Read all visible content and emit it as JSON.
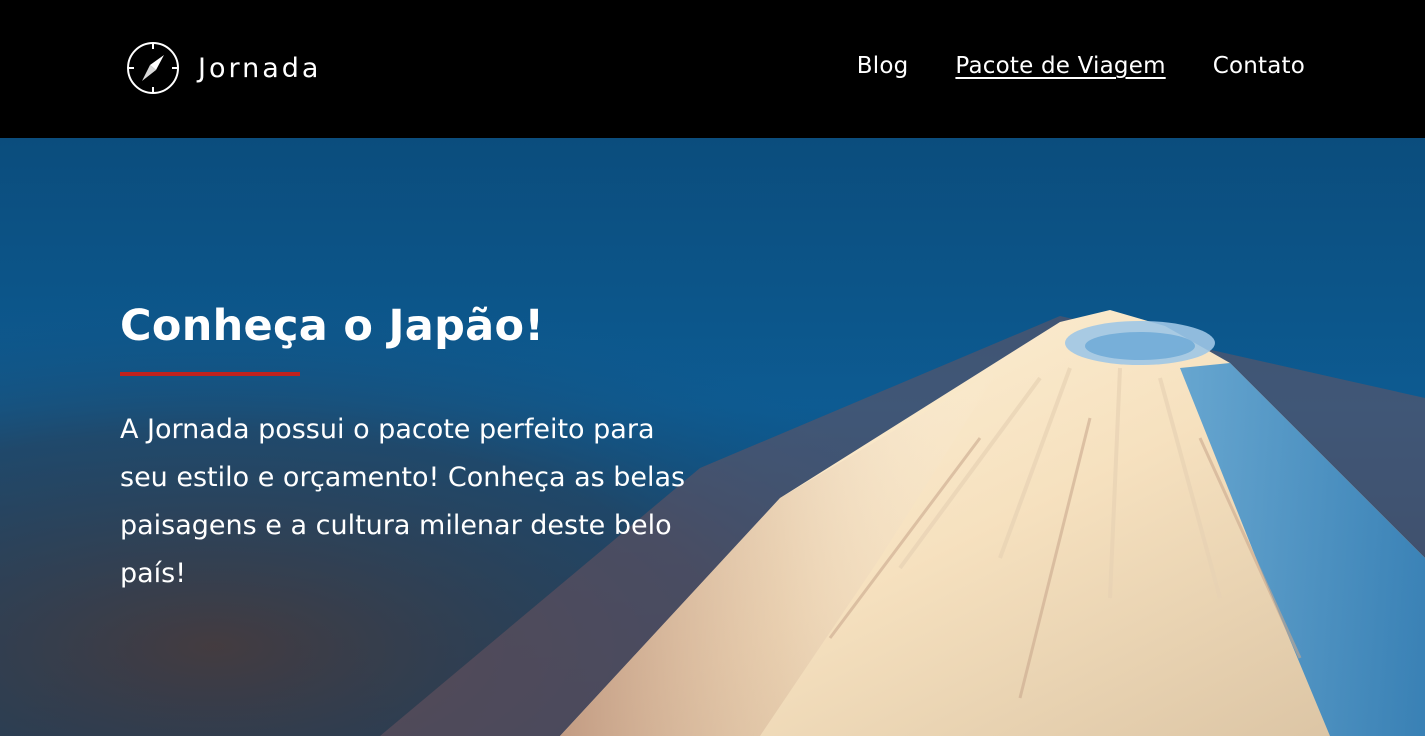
{
  "header": {
    "brand_name": "Jornada",
    "brand_icon": "compass-icon",
    "nav": [
      {
        "label": "Blog",
        "active": false
      },
      {
        "label": "Pacote de Viagem",
        "active": true
      },
      {
        "label": "Contato",
        "active": false
      }
    ]
  },
  "hero": {
    "title": "Conheça o Japão!",
    "text": "A Jornada possui o pacote perfeito para seu estilo e orçamento! Conheça as belas paisagens e a cultura milenar deste belo país!",
    "background": "mount-fuji-aerial-photo"
  },
  "colors": {
    "header_bg": "#000000",
    "accent_rule": "#c0221e",
    "sky_blue": "#0e5485",
    "text": "#ffffff"
  }
}
